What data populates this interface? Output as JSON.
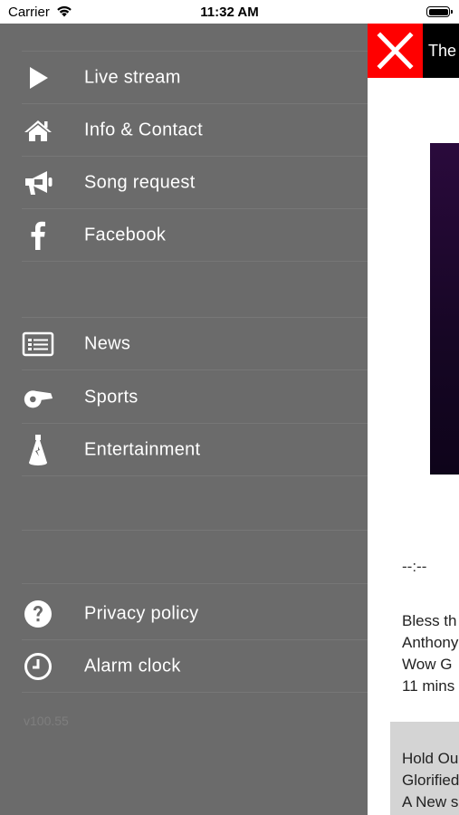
{
  "status_bar": {
    "carrier": "Carrier",
    "time": "11:32 AM"
  },
  "menu": {
    "items": [
      {
        "label": "Live stream",
        "icon": "play-icon"
      },
      {
        "label": "Info & Contact",
        "icon": "home-icon"
      },
      {
        "label": "Song request",
        "icon": "megaphone-icon"
      },
      {
        "label": "Facebook",
        "icon": "facebook-icon"
      },
      {
        "label": "News",
        "icon": "newspaper-icon"
      },
      {
        "label": "Sports",
        "icon": "whistle-icon"
      },
      {
        "label": "Entertainment",
        "icon": "spotlight-icon"
      },
      {
        "label": "Privacy policy",
        "icon": "question-icon"
      },
      {
        "label": "Alarm clock",
        "icon": "clock-icon"
      }
    ],
    "version": "v100.55"
  },
  "content": {
    "title": "The",
    "time_display": "--:--",
    "now_playing": {
      "line1": "Bless th",
      "line2": "Anthony",
      "line3": "Wow G",
      "line4": "11 mins"
    },
    "history": {
      "line1": "Hold Ou",
      "line2": "Glorified",
      "line3": "A New s"
    }
  },
  "colors": {
    "drawer": "#6b6b6b",
    "close": "#ff0000",
    "title_bar": "#000000"
  }
}
